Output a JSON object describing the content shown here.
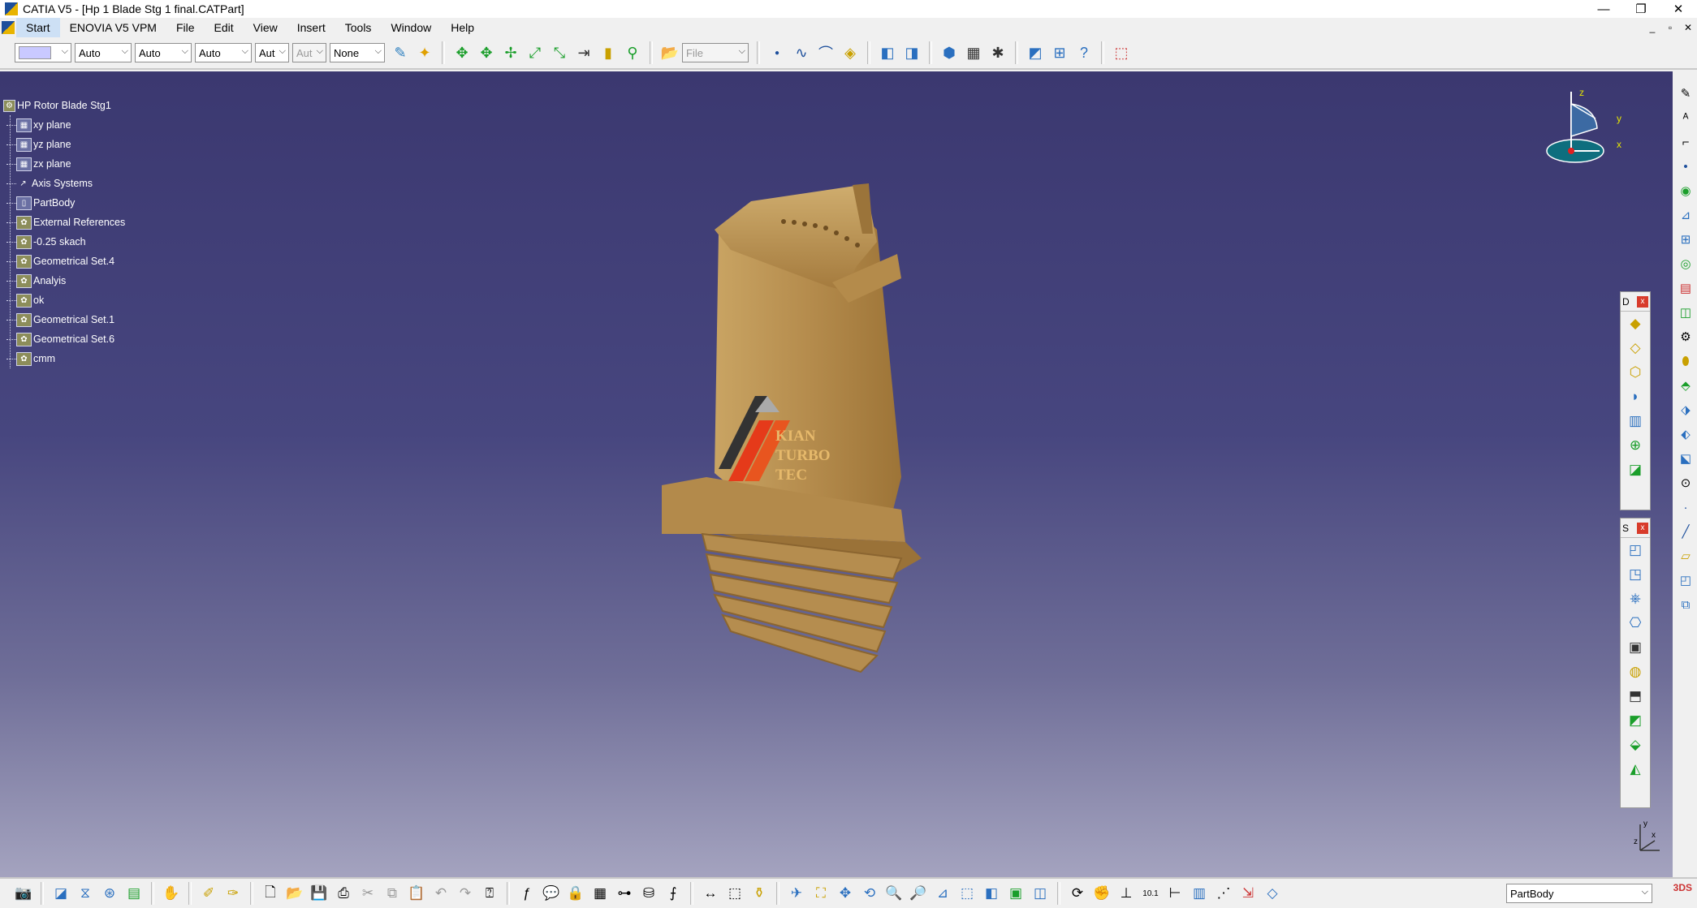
{
  "window": {
    "title": "CATIA V5 - [Hp 1 Blade Stg 1 final.CATPart]",
    "minimize": "—",
    "maximize": "❐",
    "close": "✕"
  },
  "menu": {
    "items": [
      "Start",
      "ENOVIA V5 VPM",
      "File",
      "Edit",
      "View",
      "Insert",
      "Tools",
      "Window",
      "Help"
    ]
  },
  "mdi": {
    "minimize": "_",
    "restore": "▫",
    "close": "✕"
  },
  "toolbar": {
    "combo_color": "",
    "combo_linetype": "Auto",
    "combo_thickness": "Auto",
    "combo_weight": "Auto",
    "combo_layer": "Aut",
    "combo_layer2": "Aut",
    "combo_none": "None",
    "combo_file": "File"
  },
  "tree": {
    "root": "HP Rotor Blade Stg1",
    "items": [
      {
        "label": "xy plane",
        "icon": "plane-icon"
      },
      {
        "label": "yz plane",
        "icon": "plane-icon"
      },
      {
        "label": "zx plane",
        "icon": "plane-icon"
      },
      {
        "label": "Axis Systems",
        "icon": "axis-icon"
      },
      {
        "label": "PartBody",
        "icon": "body-icon"
      },
      {
        "label": "External References",
        "icon": "geoset-icon"
      },
      {
        "label": "-0.25 skach",
        "icon": "geoset-icon"
      },
      {
        "label": "Geometrical Set.4",
        "icon": "geoset-icon"
      },
      {
        "label": "Analyis",
        "icon": "geoset-icon"
      },
      {
        "label": "ok",
        "icon": "geoset-icon"
      },
      {
        "label": "Geometrical Set.1",
        "icon": "geoset-icon"
      },
      {
        "label": "Geometrical Set.6",
        "icon": "geoset-icon"
      },
      {
        "label": "cmm",
        "icon": "geoset-icon"
      }
    ]
  },
  "watermark": {
    "line1": "KIAN",
    "line2": "TURBO TEC"
  },
  "compass": {
    "z": "z",
    "y": "y",
    "x": "x"
  },
  "floating_toolbar_1": {
    "label": "D",
    "close": "x"
  },
  "floating_toolbar_2": {
    "label": "S",
    "close": "x"
  },
  "status": {
    "current_body": "PartBody"
  },
  "bottom_right_axis": {
    "y": "y",
    "x": "x",
    "z": "z"
  }
}
